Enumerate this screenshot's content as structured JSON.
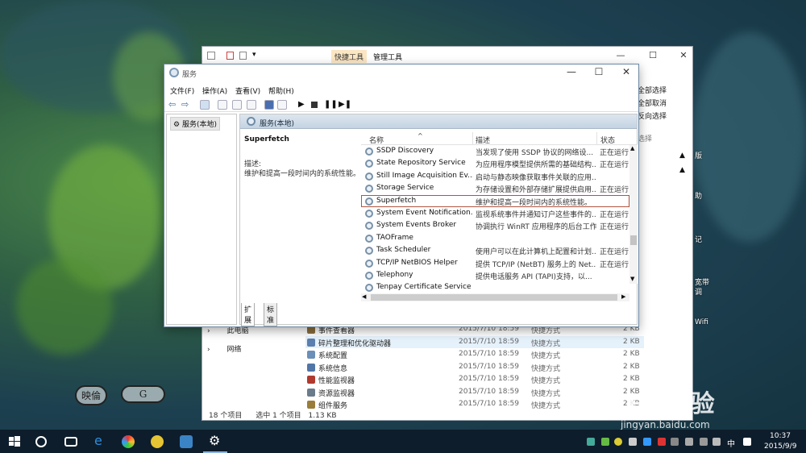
{
  "explorer": {
    "ribbon_tabs": [
      "快捷工具",
      "管理工具"
    ],
    "ribbon_right": [
      "全部选择",
      "全部取消",
      "反向选择",
      "选择"
    ],
    "sidebar": [
      "此电脑",
      "网络"
    ],
    "rows": [
      {
        "name": "事件查看器",
        "date": "2015/7/10 18:59",
        "type": "快捷方式",
        "size": "2 KB",
        "color": "#8a6d3b"
      },
      {
        "name": "碎片整理和优化驱动器",
        "date": "2015/7/10 18:59",
        "type": "快捷方式",
        "size": "2 KB",
        "color": "#5a7fb0"
      },
      {
        "name": "系统配置",
        "date": "2015/7/10 18:59",
        "type": "快捷方式",
        "size": "2 KB",
        "color": "#6a8fb8"
      },
      {
        "name": "系统信息",
        "date": "2015/7/10 18:59",
        "type": "快捷方式",
        "size": "2 KB",
        "color": "#5076a8"
      },
      {
        "name": "性能监视器",
        "date": "2015/7/10 18:59",
        "type": "快捷方式",
        "size": "2 KB",
        "color": "#b03a2e"
      },
      {
        "name": "资源监视器",
        "date": "2015/7/10 18:59",
        "type": "快捷方式",
        "size": "2 KB",
        "color": "#6a7b8c"
      },
      {
        "name": "组件服务",
        "date": "2015/7/10 18:59",
        "type": "快捷方式",
        "size": "2 KB",
        "color": "#9a7d3a"
      }
    ],
    "status": {
      "count": "18 个项目",
      "selected": "选中 1 个项目",
      "size": "1.13 KB"
    }
  },
  "services": {
    "title": "服务",
    "menu": [
      "文件(F)",
      "操作(A)",
      "查看(V)",
      "帮助(H)"
    ],
    "tree_root": "服务(本地)",
    "header": "服务(本地)",
    "detail": {
      "name": "Superfetch",
      "label": "描述:",
      "desc": "维护和提高一段时间内的系统性能。"
    },
    "columns": {
      "name": "名称",
      "desc": "描述",
      "status": "状态"
    },
    "rows": [
      {
        "name": "SSDP Discovery",
        "desc": "当发现了使用 SSDP 协议的网络设...",
        "status": "正在运行"
      },
      {
        "name": "State Repository Service",
        "desc": "为应用程序模型提供所需的基础结构...",
        "status": "正在运行"
      },
      {
        "name": "Still Image Acquisition Ev...",
        "desc": "启动与静态映像获取事件关联的应用...",
        "status": ""
      },
      {
        "name": "Storage Service",
        "desc": "为存储设置和外部存储扩展提供启用...",
        "status": "正在运行"
      },
      {
        "name": "Superfetch",
        "desc": "维护和提高一段时间内的系统性能。",
        "status": "",
        "selected": true
      },
      {
        "name": "System Event Notification...",
        "desc": "监视系统事件并通知订户这些事件的...",
        "status": "正在运行"
      },
      {
        "name": "System Events Broker",
        "desc": "协调执行 WinRT 应用程序的后台工作...",
        "status": "正在运行"
      },
      {
        "name": "TAOFrame",
        "desc": "",
        "status": ""
      },
      {
        "name": "Task Scheduler",
        "desc": "使用户可以在此计算机上配置和计划...",
        "status": "正在运行"
      },
      {
        "name": "TCP/IP NetBIOS Helper",
        "desc": "提供 TCP/IP (NetBT) 服务上的 Net...",
        "status": "正在运行"
      },
      {
        "name": "Telephony",
        "desc": "提供电话服务 API (TAPI)支持，以...",
        "status": ""
      },
      {
        "name": "Tenpay Certificate Service",
        "desc": "",
        "status": ""
      }
    ],
    "tabs": [
      "扩展",
      "标准"
    ]
  },
  "desktop_labels": [
    "版",
    "助",
    "记",
    "宽带",
    "调",
    "Wifi"
  ],
  "watermark": {
    "logo": "Bai经验",
    "url": "jingyan.baidu.com"
  },
  "stamps": [
    "映倫",
    "G"
  ],
  "taskbar": {
    "ime": "中",
    "time": "10:37",
    "date": "2015/9/9"
  }
}
